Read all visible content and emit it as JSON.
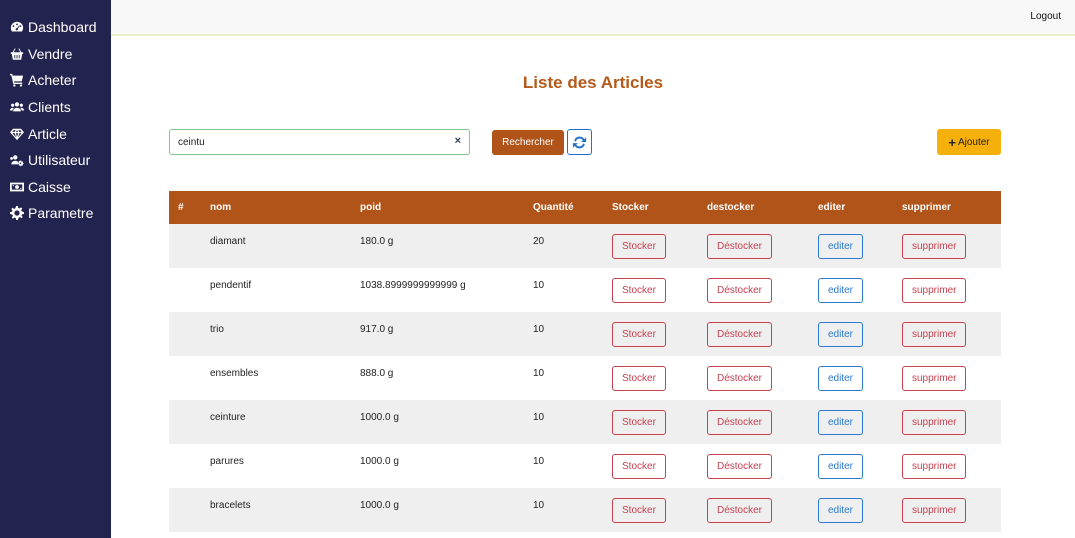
{
  "sidebar": {
    "items": [
      {
        "label": "Dashboard",
        "icon": "gauge-icon"
      },
      {
        "label": "Vendre",
        "icon": "basket-icon"
      },
      {
        "label": "Acheter",
        "icon": "cart-icon"
      },
      {
        "label": "Clients",
        "icon": "users-icon"
      },
      {
        "label": "Article",
        "icon": "gem-icon"
      },
      {
        "label": "Utilisateur",
        "icon": "users-cog-icon"
      },
      {
        "label": "Caisse",
        "icon": "money-icon"
      },
      {
        "label": "Parametre",
        "icon": "gear-icon"
      }
    ]
  },
  "topbar": {
    "logout_label": "Logout"
  },
  "page": {
    "title": "Liste des Articles"
  },
  "search": {
    "value": "ceintu",
    "clear_symbol": "×",
    "button_label": "Rechercher"
  },
  "add_button": {
    "label": "Ajouter",
    "symbol": "+"
  },
  "table": {
    "headers": [
      "#",
      "nom",
      "poid",
      "Quantité",
      "Stocker",
      "destocker",
      "editer",
      "supprimer"
    ],
    "action_labels": {
      "stocker": "Stocker",
      "destocker": "Déstocker",
      "editer": "editer",
      "supprimer": "supprimer"
    },
    "rows": [
      {
        "num": "",
        "nom": "diamant",
        "poid": "180.0 g",
        "quantite": "20"
      },
      {
        "num": "",
        "nom": "pendentif",
        "poid": "1038.8999999999999 g",
        "quantite": "10"
      },
      {
        "num": "",
        "nom": "trio",
        "poid": "917.0 g",
        "quantite": "10"
      },
      {
        "num": "",
        "nom": "ensembles",
        "poid": "888.0 g",
        "quantite": "10"
      },
      {
        "num": "",
        "nom": "ceinture",
        "poid": "1000.0 g",
        "quantite": "10"
      },
      {
        "num": "",
        "nom": "parures",
        "poid": "1000.0 g",
        "quantite": "10"
      },
      {
        "num": "",
        "nom": "bracelets",
        "poid": "1000.0 g",
        "quantite": "10"
      }
    ]
  },
  "colors": {
    "sidebar_bg": "#23234f",
    "accent_brown": "#b0541a",
    "title_color": "#b45a1a",
    "add_yellow": "#f5b00c",
    "danger": "#c9404f",
    "primary": "#2a7ad0"
  }
}
